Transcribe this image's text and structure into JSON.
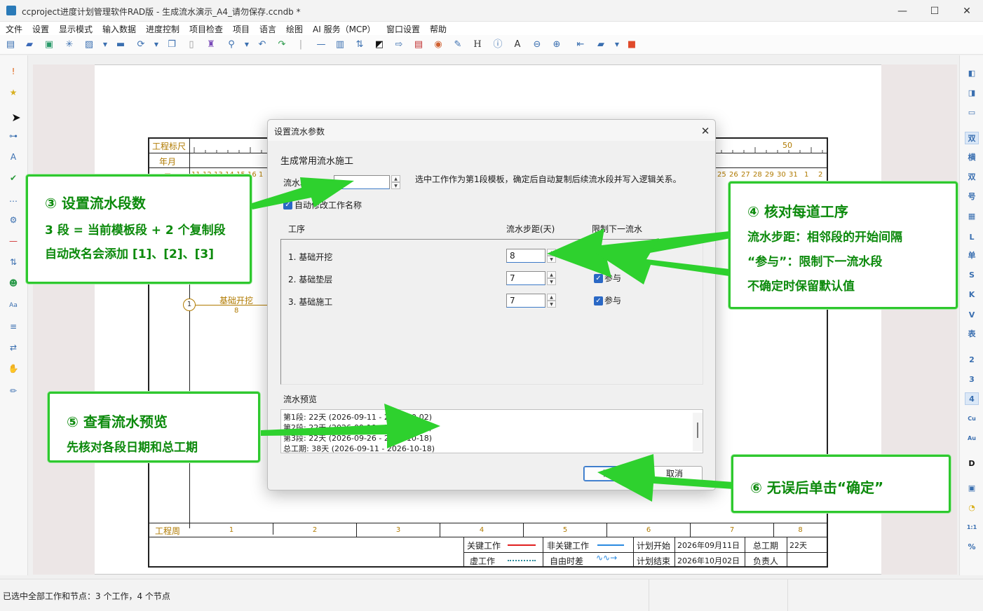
{
  "window": {
    "title": "ccproject进度计划管理软件RAD版 - 生成流水演示_A4_请勿保存.ccndb *",
    "minimize": "—",
    "maximize": "☐",
    "close": "✕"
  },
  "menu": [
    "文件",
    "设置",
    "显示模式",
    "输入数据",
    "进度控制",
    "项目检查",
    "项目",
    "语言",
    "绘图",
    "AI 服务（MCP）",
    "窗口设置",
    "帮助"
  ],
  "toolbar_icons": [
    "new-icon",
    "open-icon",
    "save-icon",
    "asterisk-icon",
    "export-icon",
    "dropdown-icon",
    "print-icon",
    "refresh-icon",
    "dropdown-icon",
    "copy-icon",
    "paste-icon",
    "format-icon",
    "search-icon",
    "dropdown-icon",
    "undo-icon",
    "redo-icon",
    "separator-icon",
    "line-icon",
    "bars-icon",
    "sort-icon",
    "contrast-icon",
    "arrow-icon",
    "calendar-icon",
    "palette-icon",
    "edit-icon",
    "h-icon",
    "info-icon",
    "text-icon",
    "zoom-out-icon",
    "zoom-in-icon",
    "back-icon",
    "folder-icon",
    "dropdown-icon",
    "toolbox-icon"
  ],
  "left_toolbar_icons": [
    "alert-icon",
    "star-icon",
    "select-pointer-icon",
    "link-icon",
    "text-style-icon",
    "check-icon",
    "dots-icon",
    "gear-icon",
    "line-icon",
    "sort-icon",
    "people-icon",
    "font-icon",
    "filter-icon",
    "swap-icon",
    "hand-icon",
    "pen-icon"
  ],
  "right_toolbar": [
    "◧",
    "◨",
    "▭",
    "双",
    "横",
    "双",
    "号",
    "▦",
    "L",
    "单",
    "S",
    "K",
    "V",
    "表",
    "2",
    "3",
    "4",
    "Cu",
    "Au",
    "D",
    "▣",
    "◔",
    "1:1",
    "%"
  ],
  "chart": {
    "label_ruler": "工程标尺",
    "label_yearmonth": "年月",
    "label_day": "日",
    "ruler_fifty": "50",
    "days_left": [
      "11",
      "12",
      "13",
      "14",
      "15",
      "16",
      "1"
    ],
    "days_right": [
      "25",
      "26",
      "27",
      "28",
      "29",
      "30",
      "31",
      "1",
      "2"
    ],
    "task_node": "1",
    "task_name": "基础开挖",
    "task_duration": "8",
    "week_label": "工程周",
    "weeks": [
      "1",
      "2",
      "3",
      "4",
      "5",
      "6",
      "7",
      "8"
    ],
    "legend": {
      "critical": "关键工作",
      "noncritical": "非关键工作",
      "dummy": "虚工作",
      "float": "自由时差",
      "plan_start_label": "计划开始",
      "plan_start_value": "2026年09月11日",
      "plan_end_label": "计划结束",
      "plan_end_value": "2026年10月02日",
      "total_label": "总工期",
      "total_value": "22天",
      "owner_label": "负责人",
      "critical_color": "#e02020",
      "noncritical_color": "#2a8ae0"
    }
  },
  "dialog": {
    "title": "设置流水参数",
    "close": "✕",
    "section_title": "生成常用流水施工",
    "segments_label": "流水段",
    "segments_value": "",
    "hint": "选中工作作为第1段模板，确定后自动复制后续流水段并写入逻辑关系。",
    "auto_rename_label": "自动修改工作名称",
    "auto_rename_checked": true,
    "col_process": "工序",
    "col_step": "流水步距(天)",
    "col_limit": "限制下一流水",
    "rows": [
      {
        "name": "1. 基础开挖",
        "step": "8",
        "limit": ""
      },
      {
        "name": "2. 基础垫层",
        "step": "7",
        "limit": "参与"
      },
      {
        "name": "3. 基础施工",
        "step": "7",
        "limit": "参与"
      }
    ],
    "preview_label": "流水预览",
    "preview_lines": [
      "第1段: 22天 (2026-09-11 - 2026-10-02)",
      "第2段: 22天 (2026-09-19 - 2026-10-10)",
      "第3段: 22天 (2026-09-26 - 2026-10-18)",
      "总工期: 38天 (2026-09-11 - 2026-10-18)"
    ],
    "ok": "确定",
    "cancel": "取消"
  },
  "callouts": {
    "c3": {
      "title": "③ 设置流水段数",
      "line1": "3 段 = 当前模板段 + 2 个复制段",
      "line2": "自动改名会添加 [1]、[2]、[3]"
    },
    "c4": {
      "title": "④ 核对每道工序",
      "line1": "流水步距：相邻段的开始间隔",
      "line2": "“参与”：限制下一流水段",
      "line3": "不确定时保留默认值"
    },
    "c5": {
      "title": "⑤ 查看流水预览",
      "line1": "先核对各段日期和总工期"
    },
    "c6": {
      "title": "⑥ 无误后单击“确定”"
    },
    "arrow_color": "#2ed12e"
  },
  "status": "已选中全部工作和节点：3 个工作，4 个节点"
}
